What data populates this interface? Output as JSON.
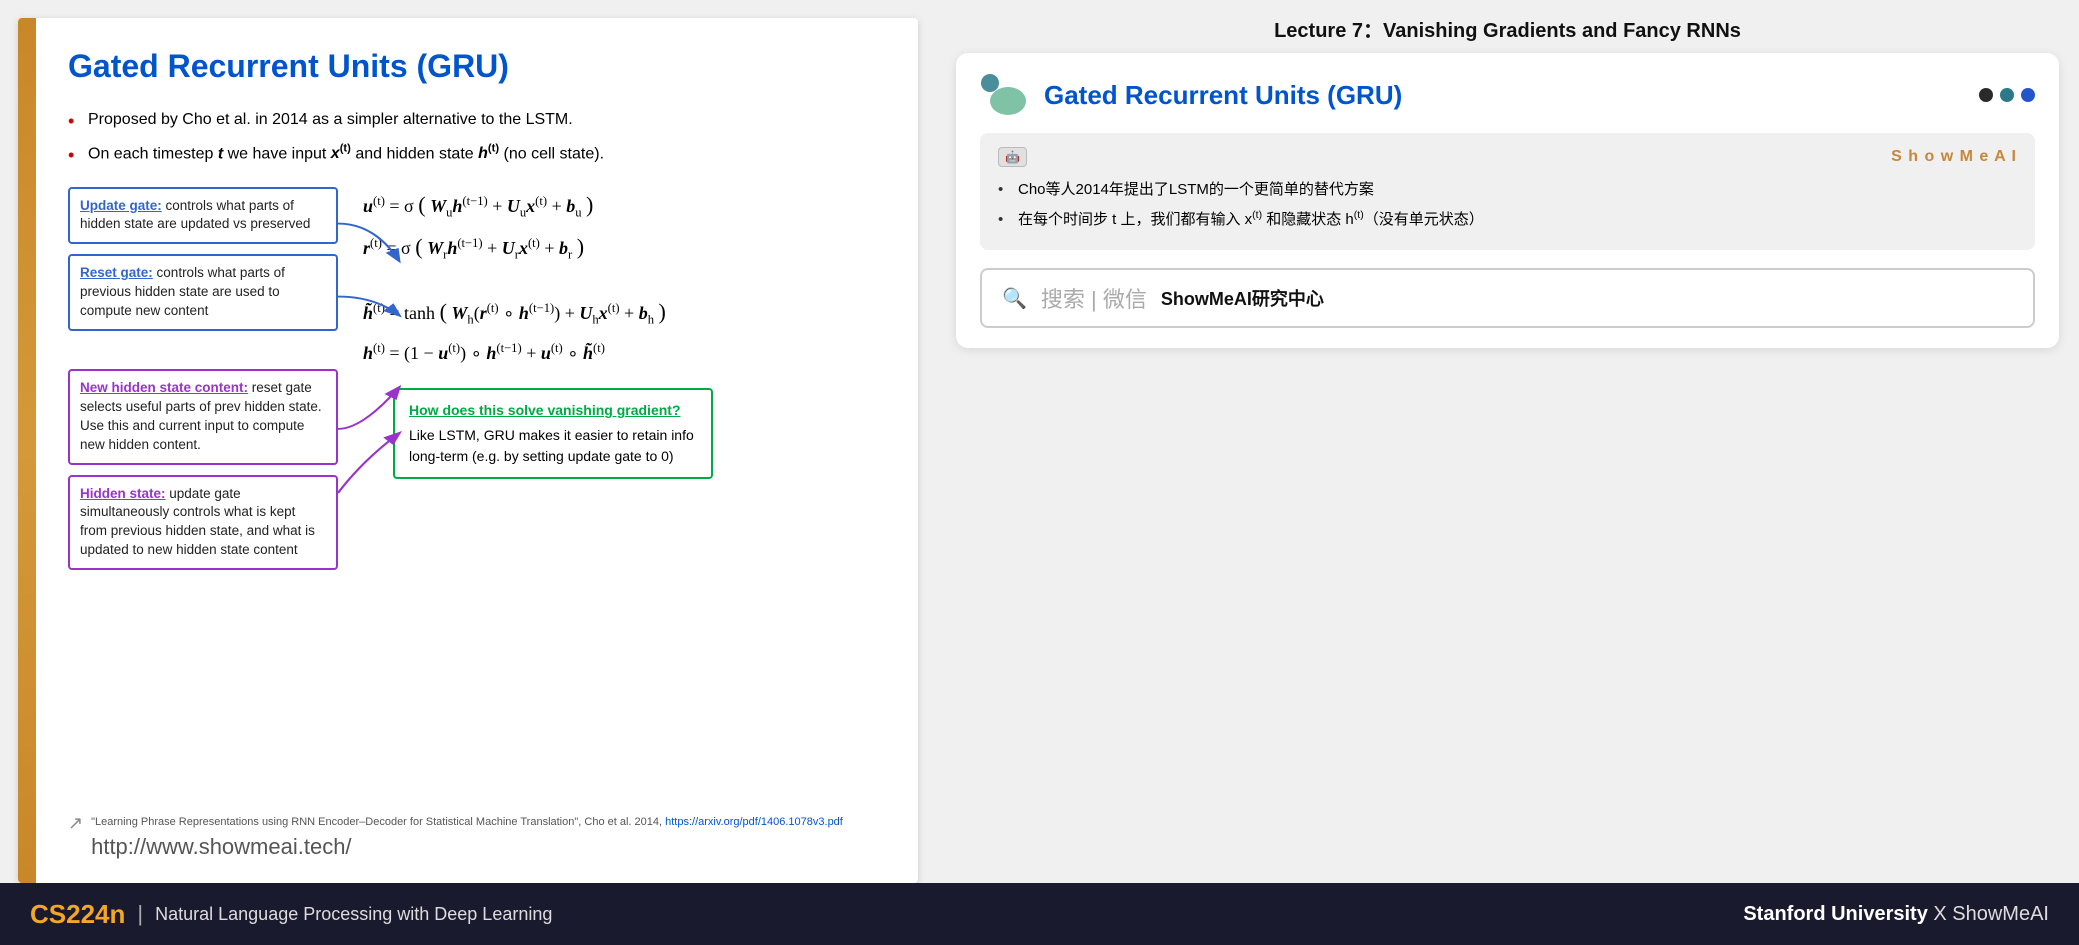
{
  "slide": {
    "title": "Gated Recurrent Units (GRU)",
    "left_bar_color": "#c8882a",
    "bullets": [
      "Proposed by Cho et al. in 2014 as a simpler alternative to the LSTM.",
      "On each timestep t we have input x(t) and hidden state h(t) (no cell state)."
    ],
    "annotations": [
      {
        "type": "blue",
        "title": "Update gate:",
        "text": "controls what parts of hidden state are updated vs preserved"
      },
      {
        "type": "blue",
        "title": "Reset gate:",
        "text": "controls what parts of previous hidden state are used to compute new content"
      },
      {
        "type": "purple",
        "title": "New hidden state content:",
        "text": "reset gate selects useful parts of prev hidden state. Use this and current input to compute new hidden content."
      },
      {
        "type": "purple",
        "title": "Hidden state:",
        "text": "update gate simultaneously controls what is kept from previous hidden state, and what is updated to new hidden state content"
      }
    ],
    "equations": [
      "u(t) = σ(W_u h(t-1) + U_u x(t) + b_u)",
      "r(t) = σ(W_r h(t-1) + U_r x(t) + b_r)",
      "h̃(t) = tanh(W_h(r(t) ∘ h(t-1)) + U_h x(t) + b_h)",
      "h(t) = (1 - u(t)) ∘ h(t-1) + u(t) ∘ h̃(t)"
    ],
    "green_box": {
      "title": "How does this solve vanishing gradient?",
      "text": "Like LSTM, GRU makes it easier to retain info long-term (e.g. by setting update gate to 0)"
    },
    "reference": {
      "text": "\"Learning Phrase Representations using RNN Encoder–Decoder for Statistical Machine Translation\", Cho et al. 2014,",
      "link": "https://arxiv.org/pdf/1406.1078v3.pdf",
      "url": "http://www.showmeai.tech/"
    }
  },
  "right_panel": {
    "lecture_title": "Lecture 7：Vanishing Gradients and Fancy RNNs",
    "card_title": "Gated Recurrent Units (GRU)",
    "showmeai": {
      "brand": "S h o w M e A I",
      "bullet1": "Cho等人2014年提出了LSTM的一个更简单的替代方案",
      "bullet2": "在每个时间步 t 上，我们都有输入 x(t) 和隐藏状态 h(t)（没有单元状态）"
    },
    "search_text": "搜索 | 微信 ShowMeAI研究中心"
  },
  "bottom_bar": {
    "course": "CS224n",
    "separator": "|",
    "description": "Natural Language Processing with Deep Learning",
    "right": "Stanford University X ShowMeAI"
  }
}
